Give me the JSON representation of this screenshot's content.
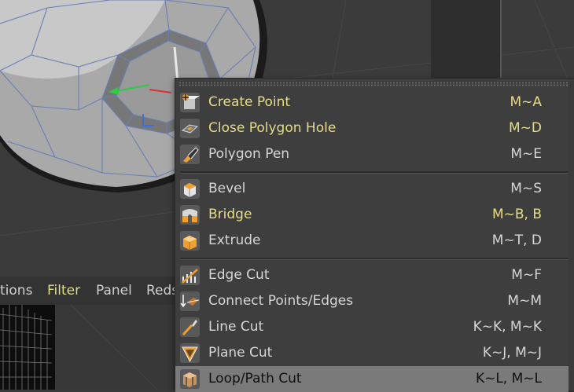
{
  "menubar": {
    "items": [
      "tions",
      "Filter",
      "Panel",
      "Reds"
    ]
  },
  "context_menu": {
    "groups": [
      [
        {
          "label": "Create Point",
          "shortcut": "M~A",
          "icon": "create-point-icon"
        },
        {
          "label": "Close Polygon Hole",
          "shortcut": "M~D",
          "icon": "close-polygon-hole-icon"
        },
        {
          "label": "Polygon Pen",
          "shortcut": "M~E",
          "icon": "polygon-pen-icon"
        }
      ],
      [
        {
          "label": "Bevel",
          "shortcut": "M~S",
          "icon": "bevel-icon"
        },
        {
          "label": "Bridge",
          "shortcut": "M~B, B",
          "icon": "bridge-icon"
        },
        {
          "label": "Extrude",
          "shortcut": "M~T, D",
          "icon": "extrude-icon"
        }
      ],
      [
        {
          "label": "Edge Cut",
          "shortcut": "M~F",
          "icon": "edge-cut-icon"
        },
        {
          "label": "Connect Points/Edges",
          "shortcut": "M~M",
          "icon": "connect-points-edges-icon"
        },
        {
          "label": "Line Cut",
          "shortcut": "K~K, M~K",
          "icon": "line-cut-icon"
        },
        {
          "label": "Plane Cut",
          "shortcut": "K~J, M~J",
          "icon": "plane-cut-icon"
        },
        {
          "label": "Loop/Path Cut",
          "shortcut": "K~L, M~L",
          "icon": "loop-path-cut-icon"
        }
      ]
    ],
    "highlighted_text_items": [
      "Create Point",
      "Close Polygon Hole",
      "Bridge"
    ],
    "active_item": "Loop/Path Cut"
  },
  "colors": {
    "menu_bg": "#3e3e3e",
    "highlight_text": "#e6dc86",
    "active_bg": "#7a7a7a",
    "icon_orange": "#f0a030",
    "mesh_wire": "#6a7fb5"
  }
}
